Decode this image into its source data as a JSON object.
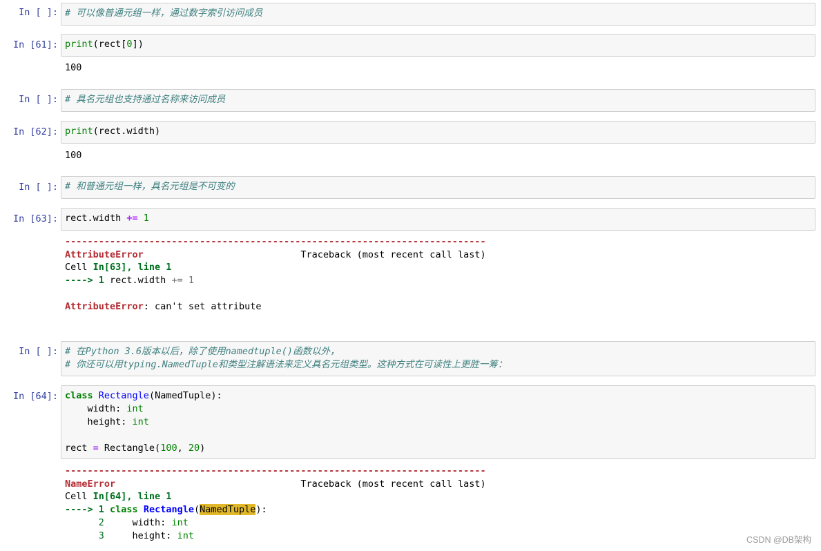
{
  "cells": [
    {
      "prompt": "In [ ]:",
      "comment": "# 可以像普通元组一样，通过数字索引访问成员"
    },
    {
      "prompt": "In [61]:",
      "code": {
        "fn": "print",
        "rest_a": "(rect[",
        "num": "0",
        "rest_b": "])"
      },
      "output": "100"
    },
    {
      "prompt": "In [ ]:",
      "comment": "# 具名元组也支持通过名称来访问成员"
    },
    {
      "prompt": "In [62]:",
      "code": {
        "fn": "print",
        "rest": "(rect.width)"
      },
      "output": "100"
    },
    {
      "prompt": "In [ ]:",
      "comment": "# 和普通元组一样，具名元组是不可变的"
    },
    {
      "prompt": "In [63]:",
      "code": {
        "lhs": "rect.width ",
        "op": "+=",
        "rhs": " 1"
      }
    },
    {
      "prompt": "In [ ]:",
      "comment_lines": [
        "# 在Python 3.6版本以后，除了使用namedtuple()函数以外，",
        "# 你还可以用typing.NamedTuple和类型注解语法来定义具名元组类型。这种方式在可读性上更胜一筹："
      ]
    },
    {
      "prompt": "In [64]:",
      "code": {
        "kw_class": "class",
        "cls_name": "Rectangle",
        "base": "(NamedTuple):",
        "field1": "    width: ",
        "type_int": "int",
        "field2": "    height: ",
        "assign_lhs": "rect ",
        "assign_op": "=",
        "assign_call": " Rectangle(",
        "n100": "100",
        "comma": ", ",
        "n20": "20",
        "close": ")"
      }
    }
  ],
  "traceback1": {
    "dashes": "---------------------------------------------------------------------------",
    "error": "AttributeError",
    "gap": "                            ",
    "traceback_label": "Traceback (most recent call last)",
    "cell_prefix": "Cell ",
    "cell_ref": "In[63], line 1",
    "arrow": "----> 1",
    "arrow_code_a": " rect.width ",
    "arrow_code_op": "+=",
    "arrow_code_b": " 1",
    "final_error": "AttributeError",
    "final_msg": ": can't set attribute"
  },
  "traceback2": {
    "dashes": "---------------------------------------------------------------------------",
    "error": "NameError",
    "gap": "                                 ",
    "traceback_label": "Traceback (most recent call last)",
    "cell_prefix": "Cell ",
    "cell_ref": "In[64], line 1",
    "arrow": "----> 1",
    "kw_class": "class",
    "cls_name": "Rectangle",
    "paren_open": "(",
    "highlight": "NamedTuple",
    "paren_close": "):",
    "line2_num": "      2",
    "line2_code": "     width: ",
    "line3_num": "      3",
    "line3_code": "     height: ",
    "type_int": "int"
  },
  "watermark": "CSDN @DB架构"
}
